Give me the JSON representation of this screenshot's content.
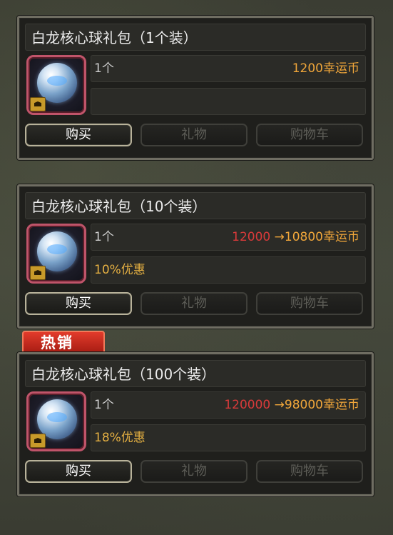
{
  "packages": [
    {
      "title": "白龙核心球礼包（1个装）",
      "quantity": "1个",
      "old_price": "",
      "price_arrow": "",
      "price": "1200幸运币",
      "discount": "",
      "icon": "dragon-core-orb-icon"
    },
    {
      "title": "白龙核心球礼包（10个装）",
      "quantity": "1个",
      "old_price": "12000",
      "price_arrow": " →",
      "price": "10800幸运币",
      "discount": "10%优惠",
      "icon": "dragon-core-orb-icon"
    },
    {
      "title": "白龙核心球礼包（100个装）",
      "quantity": "1个",
      "old_price": "120000",
      "price_arrow": " →",
      "price": "98000幸运币",
      "discount": "18%优惠",
      "icon": "dragon-core-orb-icon"
    }
  ],
  "buttons": {
    "buy": "购买",
    "gift": "礼物",
    "cart": "购物车"
  },
  "hot_tag": "热销",
  "colors": {
    "price": "#f0a63a",
    "old_price": "#d83a3a",
    "discount": "#e5b042",
    "hot_tag": "#c92a1e",
    "thumb_border": "#c0546a"
  }
}
